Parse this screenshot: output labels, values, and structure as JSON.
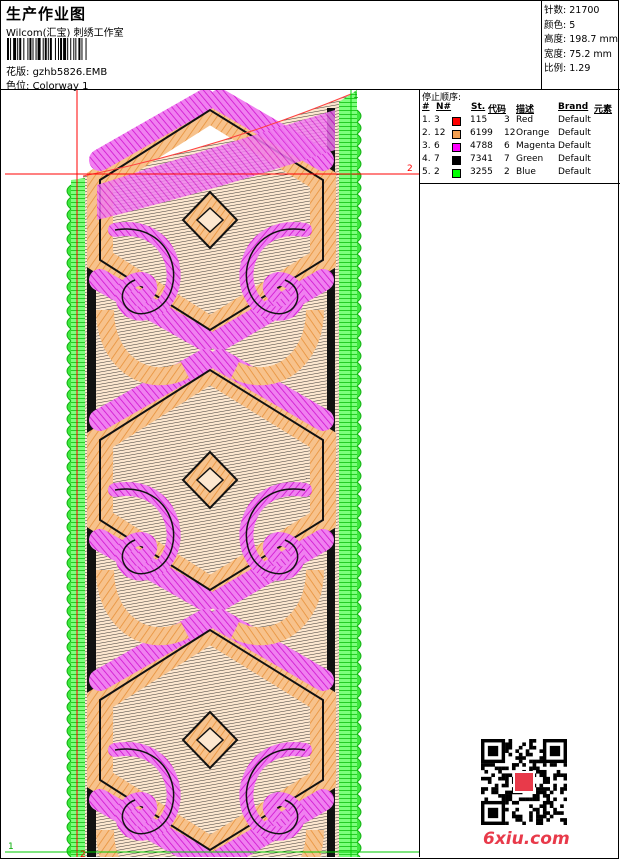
{
  "header": {
    "title": "生产作业图",
    "company": "Wilcom(汇宝) 刺绣工作室",
    "file_label": "花版:",
    "file_name": "gzhb5826.EMB",
    "colorway_label": "色位:",
    "colorway_name": "Colorway 1"
  },
  "stats": [
    {
      "label": "针数:",
      "value": "21700"
    },
    {
      "label": "颜色:",
      "value": "5"
    },
    {
      "label": "高度:",
      "value": "198.7 mm"
    },
    {
      "label": "宽度:",
      "value": "75.2 mm"
    },
    {
      "label": "比例:",
      "value": "1.29"
    }
  ],
  "stop_sequence": {
    "title": "停止顺序:",
    "headers": [
      "#",
      "N#",
      "St.",
      "代码",
      "描述",
      "Brand",
      "元素"
    ],
    "rows": [
      {
        "idx": "1.",
        "n": "3",
        "stitches": "115",
        "code": "3",
        "desc": "Red",
        "brand": "Default",
        "color": "#ff0000"
      },
      {
        "idx": "2.",
        "n": "12",
        "stitches": "6199",
        "code": "12",
        "desc": "Orange",
        "brand": "Default",
        "color": "#f5a050"
      },
      {
        "idx": "3.",
        "n": "6",
        "stitches": "4788",
        "code": "6",
        "desc": "Magenta",
        "brand": "Default",
        "color": "#ff00ff"
      },
      {
        "idx": "4.",
        "n": "7",
        "stitches": "7341",
        "code": "7",
        "desc": "Green",
        "brand": "Default",
        "color": "#000000"
      },
      {
        "idx": "5.",
        "n": "2",
        "stitches": "3255",
        "code": "2",
        "desc": "Blue",
        "brand": "Default",
        "color": "#00ff00"
      }
    ]
  },
  "guides": {
    "mark1": "1",
    "mark2": "2"
  },
  "watermark": "6xiu.com",
  "colors": {
    "orange": "#f5a050",
    "magenta": "#e040e0",
    "green": "#22dd22",
    "black": "#000000",
    "guide": "#ff0000"
  }
}
